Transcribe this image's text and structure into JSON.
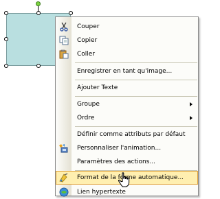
{
  "menu": {
    "items": [
      {
        "label": "Couper",
        "icon": "scissors-icon"
      },
      {
        "label": "Copier",
        "icon": "copy-icon"
      },
      {
        "label": "Coller",
        "icon": "paste-icon"
      },
      {
        "label": "Enregistrer en tant qu'image..."
      },
      {
        "label": "Ajouter Texte"
      },
      {
        "label": "Groupe",
        "submenu": true
      },
      {
        "label": "Ordre",
        "submenu": true
      },
      {
        "label": "Définir comme attributs par défaut"
      },
      {
        "label": "Personnaliser l'animation...",
        "icon": "animation-icon"
      },
      {
        "label": "Paramètres des actions..."
      },
      {
        "label": "Format de la forme automatique...",
        "icon": "format-shape-icon",
        "highlighted": true
      },
      {
        "label": "Lien hypertexte",
        "icon": "hyperlink-icon"
      }
    ]
  },
  "colors": {
    "highlight_bg": "#ffefb0",
    "highlight_border": "#e1a23a",
    "shape_fill": "#b9dfe0"
  }
}
